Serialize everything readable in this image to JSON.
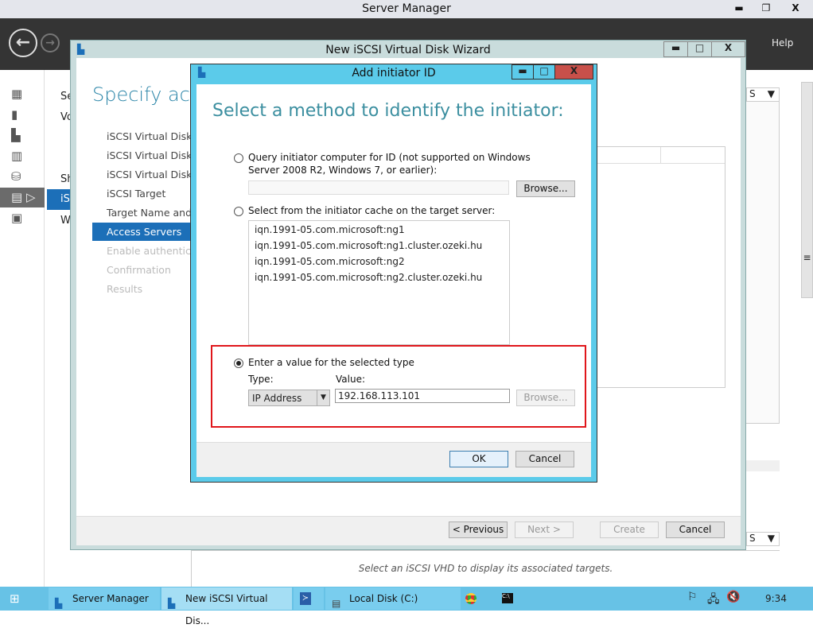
{
  "window": {
    "title": "Server Manager",
    "minimize": "▬",
    "restore": "❐",
    "close": "X"
  },
  "header": {
    "help": "Help",
    "back_icon": "arrow-left-icon",
    "forward_icon": "arrow-right-icon"
  },
  "nav": {
    "icons": [
      "dashboard-icon",
      "local-server-icon",
      "all-servers-icon",
      "file-storage-icon",
      "iis-icon",
      "file-services-icon",
      "roles-icon"
    ],
    "selected_index": 5
  },
  "col2": {
    "items": [
      "Se",
      "Vo",
      "Sh",
      "iS",
      "W"
    ],
    "selected": "iS"
  },
  "wizard": {
    "title": "New iSCSI Virtual Disk Wizard",
    "heading": "Specify acce",
    "steps": [
      {
        "label": "iSCSI Virtual Disk Lo",
        "state": "done"
      },
      {
        "label": "iSCSI Virtual Disk N",
        "state": "done"
      },
      {
        "label": "iSCSI Virtual Disk Si",
        "state": "done"
      },
      {
        "label": "iSCSI Target",
        "state": "done"
      },
      {
        "label": "Target Name and A",
        "state": "done"
      },
      {
        "label": "Access Servers",
        "state": "current"
      },
      {
        "label": "Enable authenticati",
        "state": "disabled"
      },
      {
        "label": "Confirmation",
        "state": "disabled"
      },
      {
        "label": "Results",
        "state": "disabled"
      }
    ],
    "buttons": {
      "previous": "< Previous",
      "next": "Next >",
      "create": "Create",
      "cancel": "Cancel"
    }
  },
  "dialog": {
    "title": "Add initiator ID",
    "heading": "Select a method to identify the initiator:",
    "option_query": {
      "line1": "Query initiator computer for ID (not supported on Windows",
      "line2": "Server 2008 R2, Windows 7, or earlier):",
      "value": "",
      "browse": "Browse...",
      "selected": false
    },
    "option_cache": {
      "label": "Select from the initiator cache on the target server:",
      "items": [
        "iqn.1991-05.com.microsoft:ng1",
        "iqn.1991-05.com.microsoft:ng1.cluster.ozeki.hu",
        "iqn.1991-05.com.microsoft:ng2",
        "iqn.1991-05.com.microsoft:ng2.cluster.ozeki.hu"
      ],
      "selected": false
    },
    "option_value": {
      "label": "Enter a value for the selected type",
      "type_label": "Type:",
      "type_value": "IP Address",
      "value_label": "Value:",
      "value": "192.168.113.101",
      "browse": "Browse...",
      "selected": true
    },
    "ok": "OK",
    "cancel": "Cancel",
    "highlight_color": "#e0161b"
  },
  "background": {
    "dropdown_1": "S",
    "dropdown_2": "S",
    "hint": "Select an iSCSI VHD to display its associated targets."
  },
  "taskbar": {
    "items": [
      "Server Manager",
      "New iSCSI Virtual Dis...",
      "",
      "Local Disk (C:)",
      "",
      ""
    ],
    "clock": "9:34"
  }
}
